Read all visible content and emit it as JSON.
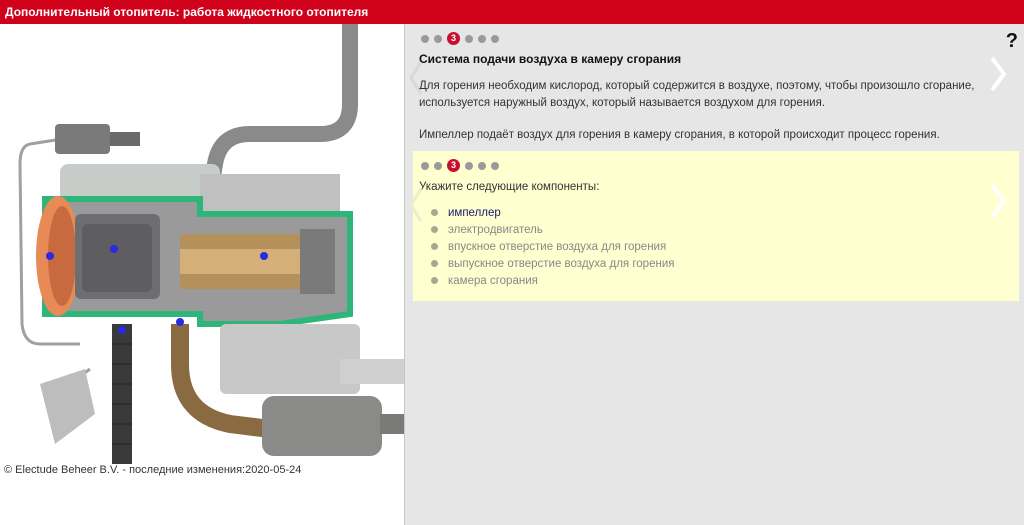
{
  "window": {
    "title": "Дополнительный отопитель: работа жидкостного отопителя"
  },
  "footer": {
    "copyright": "© Electude Beheer B.V. - последние изменения:2020-05-24"
  },
  "help": {
    "label": "?"
  },
  "info": {
    "step_current": "3",
    "title": "Система подачи воздуха в камеру сгорания",
    "paragraph1_line1": "Для горения необходим кислород, который содержится в воздухе, поэтому, чтобы произошло сгорание,",
    "paragraph1_line2": "используется наружный воздух, который называется воздухом для горения.",
    "paragraph2": "Импеллер подаёт воздух для горения в камеру сгорания, в которой происходит процесс горения."
  },
  "task": {
    "step_current": "3",
    "prompt": "Укажите следующие компоненты:",
    "components": [
      "импеллер",
      "электродвигатель",
      "впускное отверстие воздуха для горения",
      "выпускное отверстие воздуха для горения",
      "камера сгорания"
    ]
  },
  "colors": {
    "brand": "#d0021b",
    "task_bg": "#ffffd0",
    "marker": "#2a2ae0",
    "coolant": "#2db57a"
  }
}
